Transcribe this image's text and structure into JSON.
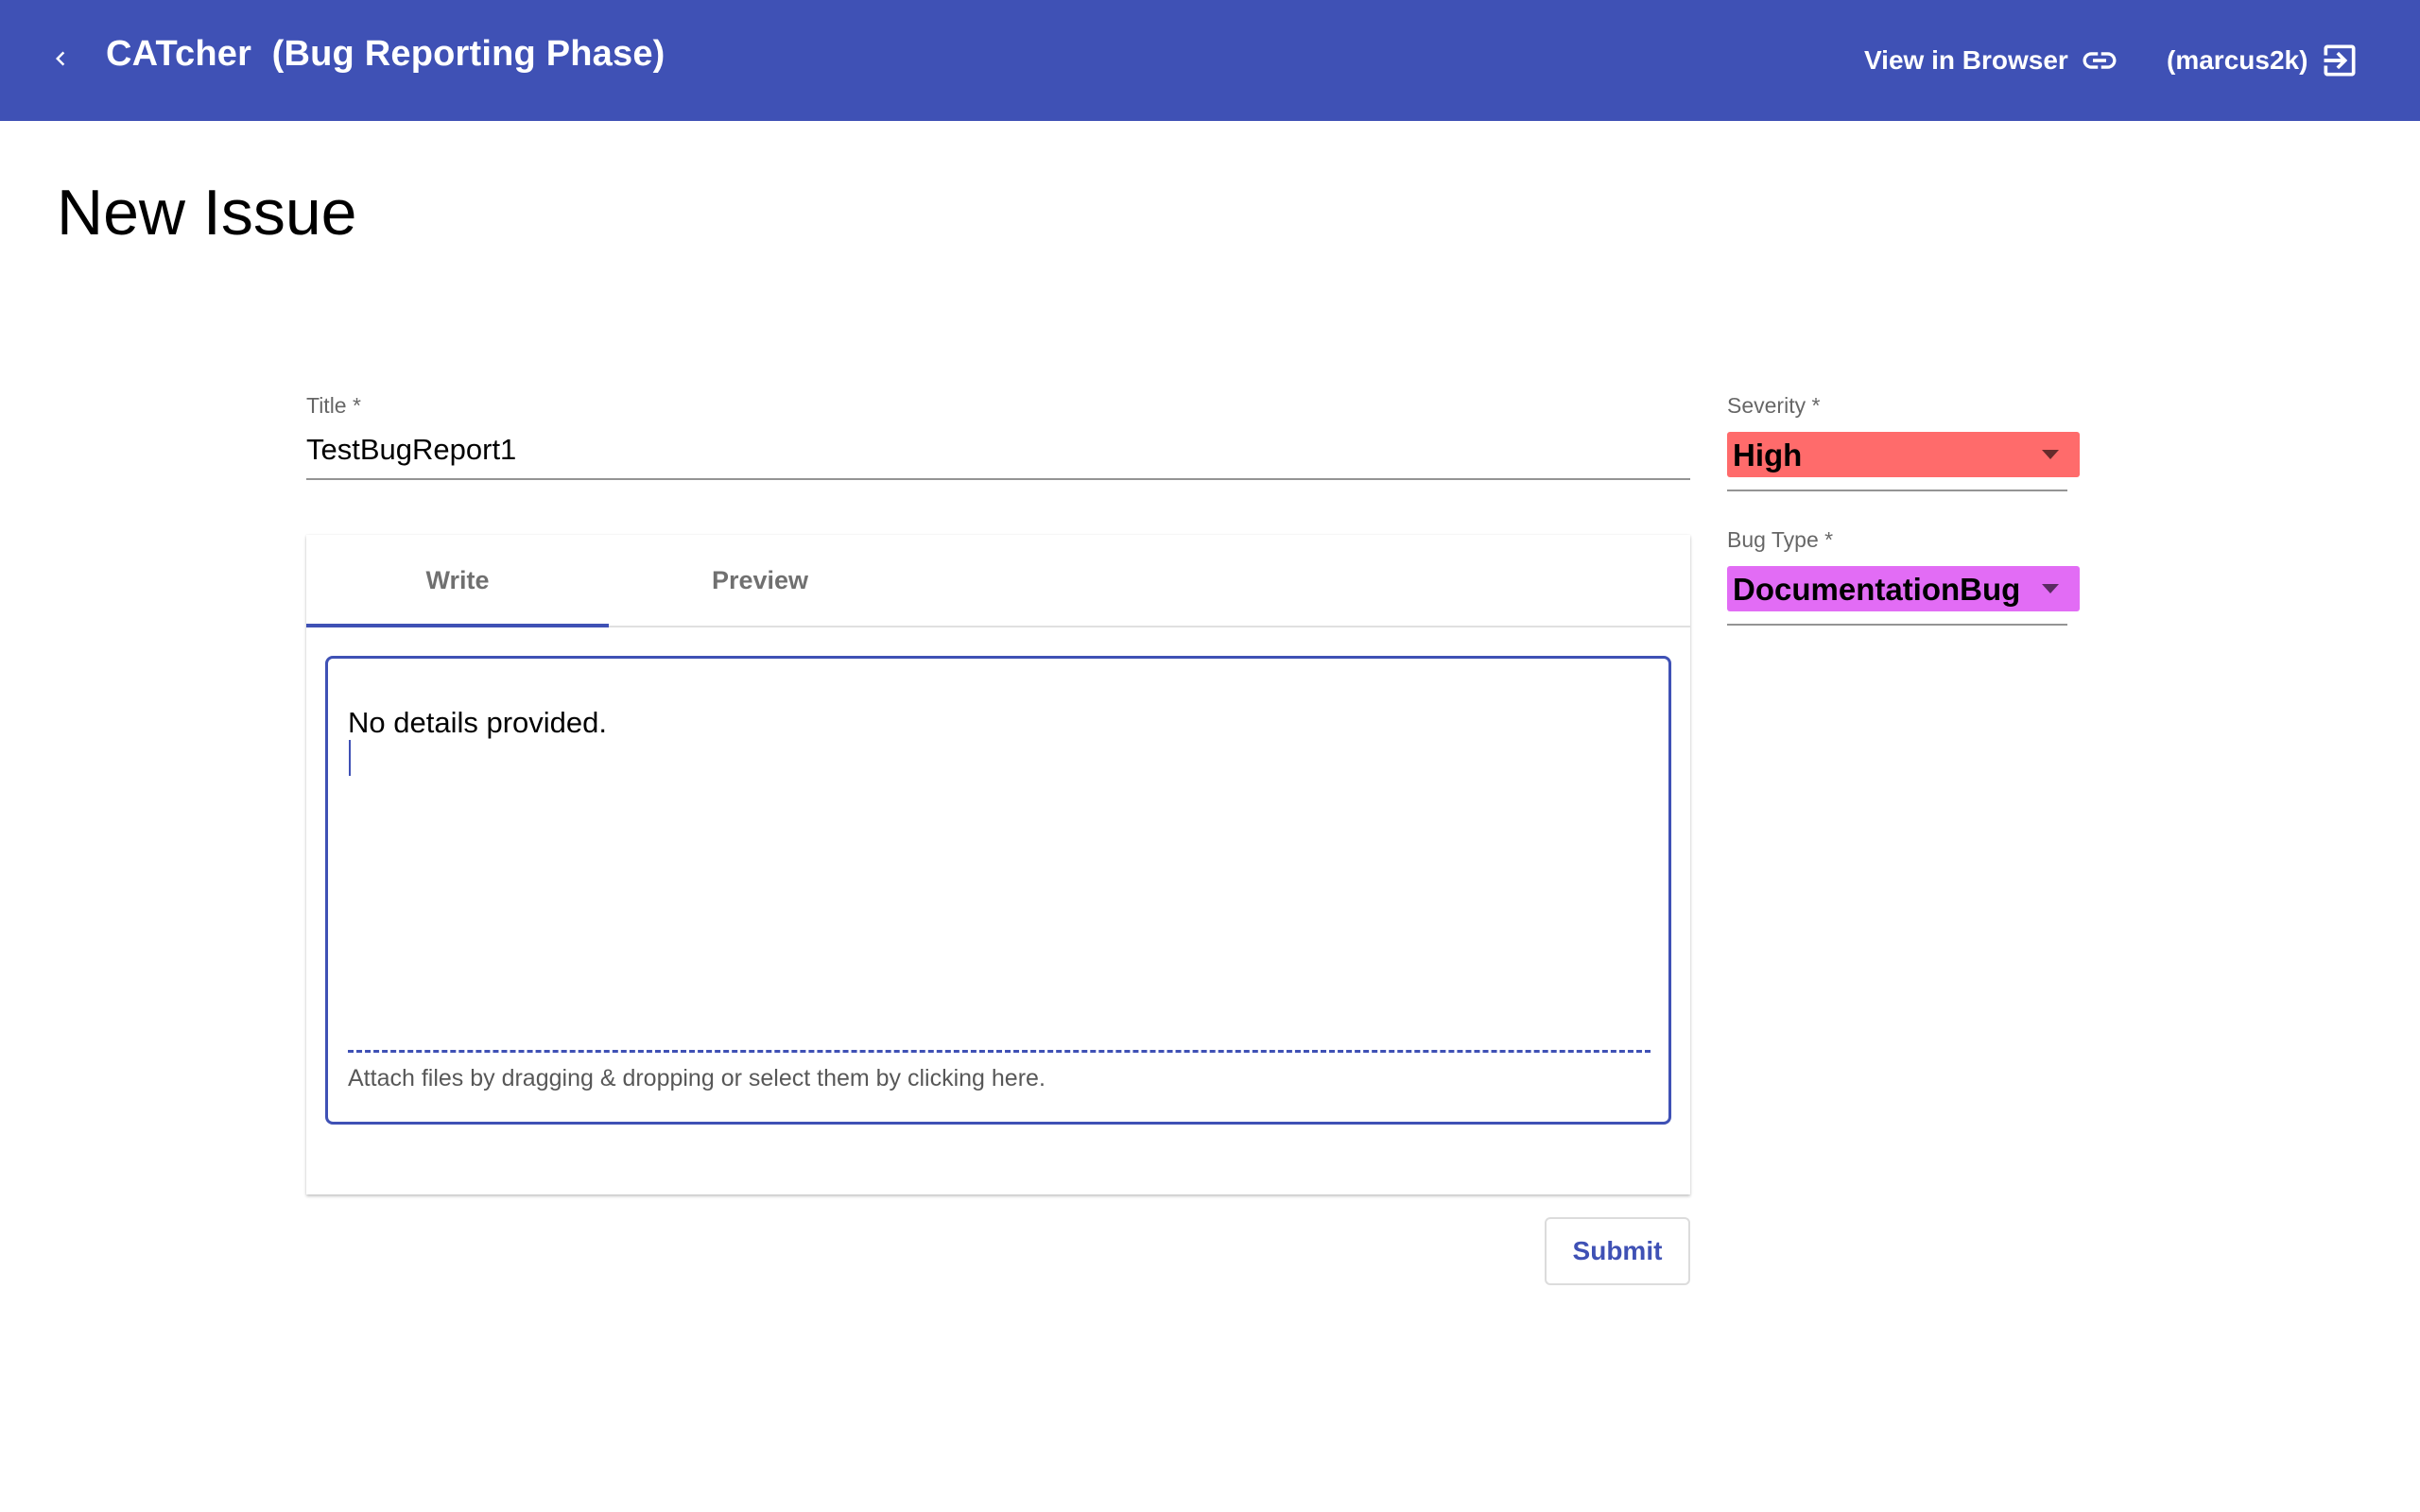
{
  "toolbar": {
    "back_icon": "chevron-left-icon",
    "app_name": "CATcher",
    "phase": "(Bug Reporting Phase)",
    "view_in_browser": "View in Browser",
    "view_in_browser_icon": "link-icon",
    "username": "(marcus2k)",
    "logout_icon": "logout-icon",
    "color": "#3f51b5"
  },
  "page": {
    "title": "New Issue"
  },
  "form": {
    "title_label": "Title *",
    "title_value": "TestBugReport1",
    "tabs": [
      {
        "label": "Write",
        "active": true
      },
      {
        "label": "Preview",
        "active": false
      }
    ],
    "description_value": "No details provided.",
    "attach_hint": "Attach files by dragging & dropping or select them by clicking here.",
    "submit_label": "Submit"
  },
  "sidebar": {
    "severity_label": "Severity *",
    "severity_value": "High",
    "severity_color": "#ff6b6b",
    "bug_type_label": "Bug Type *",
    "bug_type_value": "DocumentationBug",
    "bug_type_color": "#e26cf5"
  }
}
